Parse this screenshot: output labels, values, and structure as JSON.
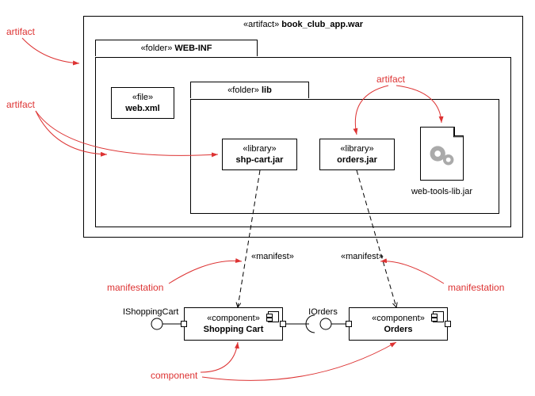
{
  "artifact_main": {
    "stereo": "«artifact»",
    "name": "book_club_app.war"
  },
  "folder_webinf": {
    "stereo": "«folder»",
    "name": "WEB-INF"
  },
  "file_webxml": {
    "stereo": "«file»",
    "name": "web.xml"
  },
  "folder_lib": {
    "stereo": "«folder»",
    "name": "lib"
  },
  "lib_shpcart": {
    "stereo": "«library»",
    "name": "shp-cart.jar"
  },
  "lib_orders": {
    "stereo": "«library»",
    "name": "orders.jar"
  },
  "lib_webtools": {
    "name": "web-tools-lib.jar"
  },
  "manifest1": "«manifest»",
  "manifest2": "«manifest»",
  "comp_shopping": {
    "stereo": "«component»",
    "name": "Shopping Cart"
  },
  "comp_orders": {
    "stereo": "«component»",
    "name": "Orders"
  },
  "iface_ishoppingcart": "IShoppingCart",
  "iface_iorders": "IOrders",
  "callout_artifact1": "artifact",
  "callout_artifact2": "artifact",
  "callout_artifact3": "artifact",
  "callout_manifest1": "manifestation",
  "callout_manifest2": "manifestation",
  "callout_component": "component"
}
